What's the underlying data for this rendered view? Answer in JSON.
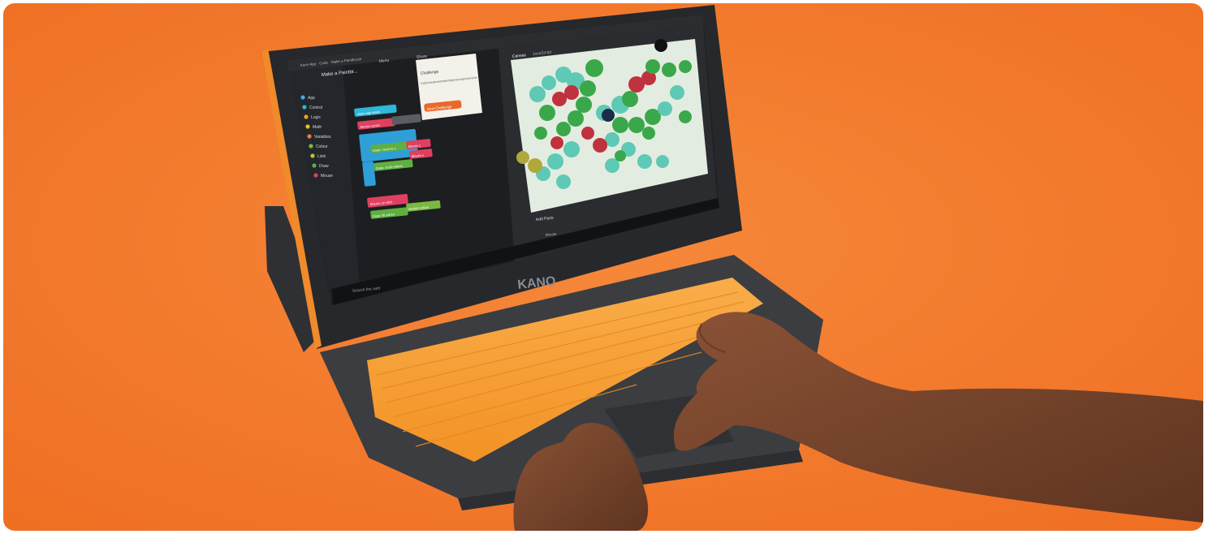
{
  "scene": {
    "background_color": "#f47a2c",
    "keyboard_color": "#f7a13a",
    "device_color": "#3a3c40"
  },
  "screen": {
    "window_title": "Kano App · Code · Make a Paintbrush",
    "menu_label": "Menu",
    "share_label": "Share",
    "project_title": "Make a Paintbr...",
    "categories": [
      {
        "label": "App",
        "color": "#3fa9f5"
      },
      {
        "label": "Control",
        "color": "#2fb6d8"
      },
      {
        "label": "Logic",
        "color": "#f0a020"
      },
      {
        "label": "Math",
        "color": "#e8c020"
      },
      {
        "label": "Variables",
        "color": "#f08030"
      },
      {
        "label": "Colour",
        "color": "#7ab840"
      },
      {
        "label": "Lists",
        "color": "#c0c030"
      },
      {
        "label": "Draw",
        "color": "#60b040"
      },
      {
        "label": "Mouse",
        "color": "#e04060"
      }
    ],
    "blocks": {
      "app_starts": "when app starts",
      "mouse_cursor": "Mouse cursor",
      "move_to": "Draw: move to x",
      "mouse_x": "Mouse x",
      "mouse_y": "Mouse y",
      "circle_radius": "Draw: circle radius",
      "on_click": "Mouse: on click",
      "fill_colour": "Draw: fill colour",
      "random_colour": "random colour"
    },
    "challenge": {
      "title": "Challenge",
      "text": "Try moving the mouse pointer around the canvas and clicking the mouse to change the colour of the brush!",
      "button": "Next Challenge"
    },
    "tabs": [
      "Canvas",
      "JavaScript"
    ],
    "add_parts_label": "Add Parts",
    "mouse_part_label": "Mouse",
    "taskbar_search": "Search the web"
  },
  "device_brand": "KANO"
}
